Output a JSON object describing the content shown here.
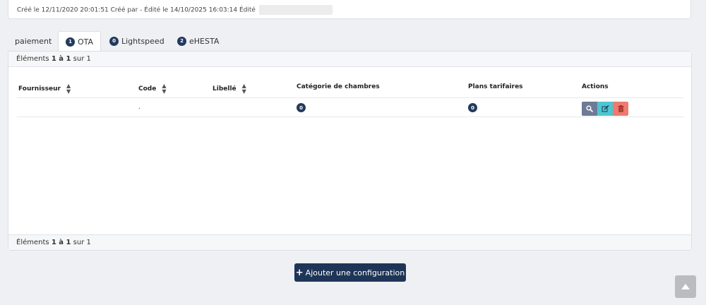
{
  "meta": {
    "text": "Créé le 12/11/2020 20:01:51 Créé par - Édité le 14/10/2025 16:03:14 Édité"
  },
  "tabs": [
    {
      "label": "paiement",
      "badge": ""
    },
    {
      "label": "OTA",
      "badge": "1"
    },
    {
      "label": "Lightspeed",
      "badge": "0"
    },
    {
      "label": "eHESTA",
      "badge": "2"
    }
  ],
  "pagination": {
    "prefix": "Éléments",
    "range": "1 à 1",
    "suffix": "sur 1"
  },
  "table": {
    "headers": [
      "Fournisseur",
      "Code",
      "Libellé",
      "Catégorie de chambres",
      "Plans tarifaires",
      "Actions"
    ],
    "row": {
      "fournisseur": "",
      "code": ".",
      "libelle": "",
      "categorie_badge": "0",
      "plans_badge": "0"
    }
  },
  "icons": {
    "view": "search-icon",
    "edit": "edit-icon",
    "delete": "trash-icon",
    "scroll": "chevron-up-icon"
  },
  "colors": {
    "primary": "#1f3558",
    "view": "#6c7b96",
    "edit": "#4fc6d0",
    "delete": "#ee7a70"
  },
  "add_button": {
    "label": "Ajouter une configuration"
  }
}
